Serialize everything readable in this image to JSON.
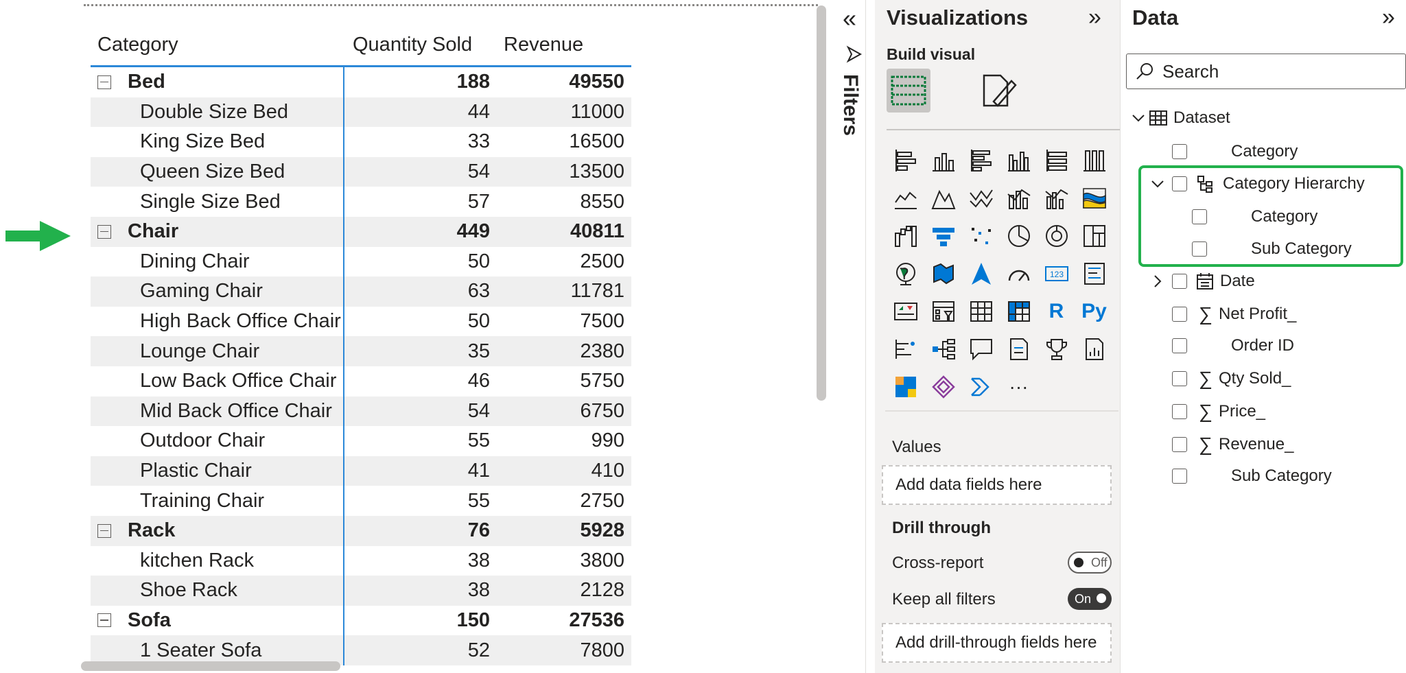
{
  "matrix": {
    "headers": {
      "category": "Category",
      "qty": "Quantity Sold",
      "revenue": "Revenue"
    },
    "rows": [
      {
        "type": "parent",
        "label": "Bed",
        "qty": "188",
        "revenue": "49550"
      },
      {
        "type": "child",
        "label": "Double Size Bed",
        "qty": "44",
        "revenue": "11000"
      },
      {
        "type": "child",
        "label": "King Size Bed",
        "qty": "33",
        "revenue": "16500"
      },
      {
        "type": "child",
        "label": "Queen Size Bed",
        "qty": "54",
        "revenue": "13500"
      },
      {
        "type": "child",
        "label": "Single Size Bed",
        "qty": "57",
        "revenue": "8550"
      },
      {
        "type": "parent",
        "label": "Chair",
        "qty": "449",
        "revenue": "40811"
      },
      {
        "type": "child",
        "label": "Dining Chair",
        "qty": "50",
        "revenue": "2500"
      },
      {
        "type": "child",
        "label": "Gaming Chair",
        "qty": "63",
        "revenue": "11781"
      },
      {
        "type": "child",
        "label": "High Back Office Chair",
        "qty": "50",
        "revenue": "7500"
      },
      {
        "type": "child",
        "label": "Lounge Chair",
        "qty": "35",
        "revenue": "2380"
      },
      {
        "type": "child",
        "label": "Low Back Office Chair",
        "qty": "46",
        "revenue": "5750"
      },
      {
        "type": "child",
        "label": "Mid Back Office Chair",
        "qty": "54",
        "revenue": "6750"
      },
      {
        "type": "child",
        "label": "Outdoor Chair",
        "qty": "55",
        "revenue": "990"
      },
      {
        "type": "child",
        "label": "Plastic Chair",
        "qty": "41",
        "revenue": "410"
      },
      {
        "type": "child",
        "label": "Training Chair",
        "qty": "55",
        "revenue": "2750"
      },
      {
        "type": "parent",
        "label": "Rack",
        "qty": "76",
        "revenue": "5928"
      },
      {
        "type": "child",
        "label": "kitchen Rack",
        "qty": "38",
        "revenue": "3800"
      },
      {
        "type": "child",
        "label": "Shoe Rack",
        "qty": "38",
        "revenue": "2128"
      },
      {
        "type": "parent",
        "label": "Sofa",
        "qty": "150",
        "revenue": "27536"
      },
      {
        "type": "child",
        "label": "1 Seater Sofa",
        "qty": "52",
        "revenue": "7800"
      }
    ]
  },
  "filters": {
    "collapse_glyph": "«",
    "label": "Filters"
  },
  "visualizations": {
    "title": "Visualizations",
    "expand_glyph": "»",
    "build_label": "Build visual",
    "more_glyph": "···",
    "r_label": "R",
    "py_label": "Py",
    "values_label": "Values",
    "values_placeholder": "Add data fields here",
    "drill_label": "Drill through",
    "cross_report_label": "Cross-report",
    "cross_report_state": "Off",
    "keep_filters_label": "Keep all filters",
    "keep_filters_state": "On",
    "drill_placeholder": "Add drill-through fields here"
  },
  "data_pane": {
    "title": "Data",
    "expand_glyph": "»",
    "search_placeholder": "Search",
    "dataset": "Dataset",
    "fields": {
      "category": "Category",
      "category_hierarchy": "Category Hierarchy",
      "h_category": "Category",
      "h_sub_category": "Sub Category",
      "date": "Date",
      "net_profit": "Net Profit_",
      "order_id": "Order ID",
      "qty_sold": "Qty Sold_",
      "price": "Price_",
      "revenue": "Revenue_",
      "sub_category": "Sub Category"
    }
  },
  "colors": {
    "accent": "#2b88d8",
    "highlight": "#22b14c",
    "arrow": "#22b14c"
  }
}
